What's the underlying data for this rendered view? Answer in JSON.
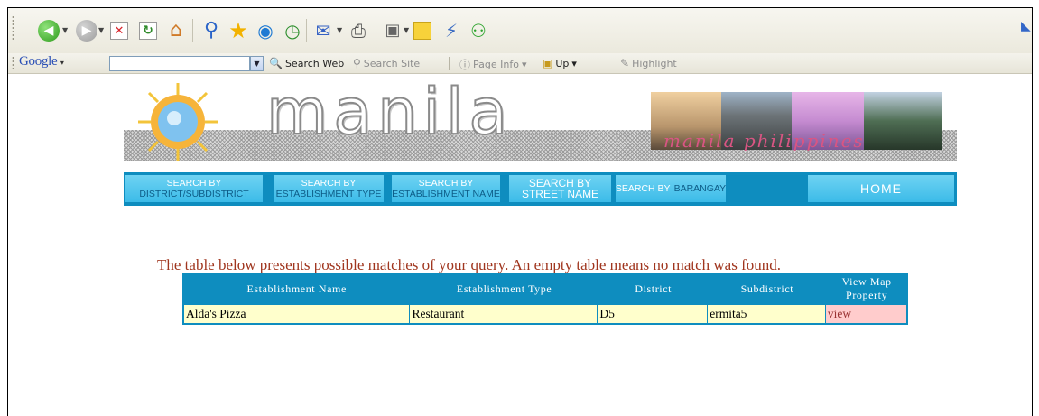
{
  "browser": {
    "toolbar_icons": [
      "back-icon",
      "forward-icon",
      "stop-icon",
      "refresh-icon",
      "home-icon",
      "search-icon",
      "favorites-icon",
      "media-icon",
      "history-icon",
      "mail-icon",
      "print-icon",
      "edit-icon",
      "note-icon",
      "plugin-icon",
      "messenger-icon"
    ],
    "google_toolbar": {
      "logo": "Google",
      "search_value": "",
      "search_web": "Search Web",
      "search_site": "Search Site",
      "page_info": "Page Info",
      "up": "Up",
      "highlight": "Highlight"
    }
  },
  "site": {
    "logo_text": "manila",
    "tagline": "manila philippines",
    "colors": {
      "nav_bg": "#0e8dbf",
      "button_bg": "#3bbbe8",
      "caption": "#a0361f",
      "cell_bg": "#ffffcc",
      "link_cell_bg": "#ffcccc"
    }
  },
  "nav": {
    "district": [
      "SEARCH BY",
      "DISTRICT/SUBDISTRICT"
    ],
    "estab_type": [
      "SEARCH BY",
      "ESTABLISHMENT TYPE"
    ],
    "estab_name": [
      "SEARCH BY",
      "ESTABLISHMENT NAME"
    ],
    "street": [
      "SEARCH  BY",
      "STREET NAME"
    ],
    "barangay": [
      "SEARCH  BY",
      "BARANGAY"
    ],
    "home": "HOME"
  },
  "results": {
    "caption": "The table below presents possible matches of your query. An empty table means no match was found.",
    "headers": [
      "Establishment Name",
      "Establishment Type",
      "District",
      "Subdistrict",
      "View Map Property"
    ],
    "rows": [
      {
        "name": "Alda's Pizza",
        "type": "Restaurant",
        "district": "D5",
        "subdistrict": "ermita5",
        "link": "view"
      }
    ]
  }
}
